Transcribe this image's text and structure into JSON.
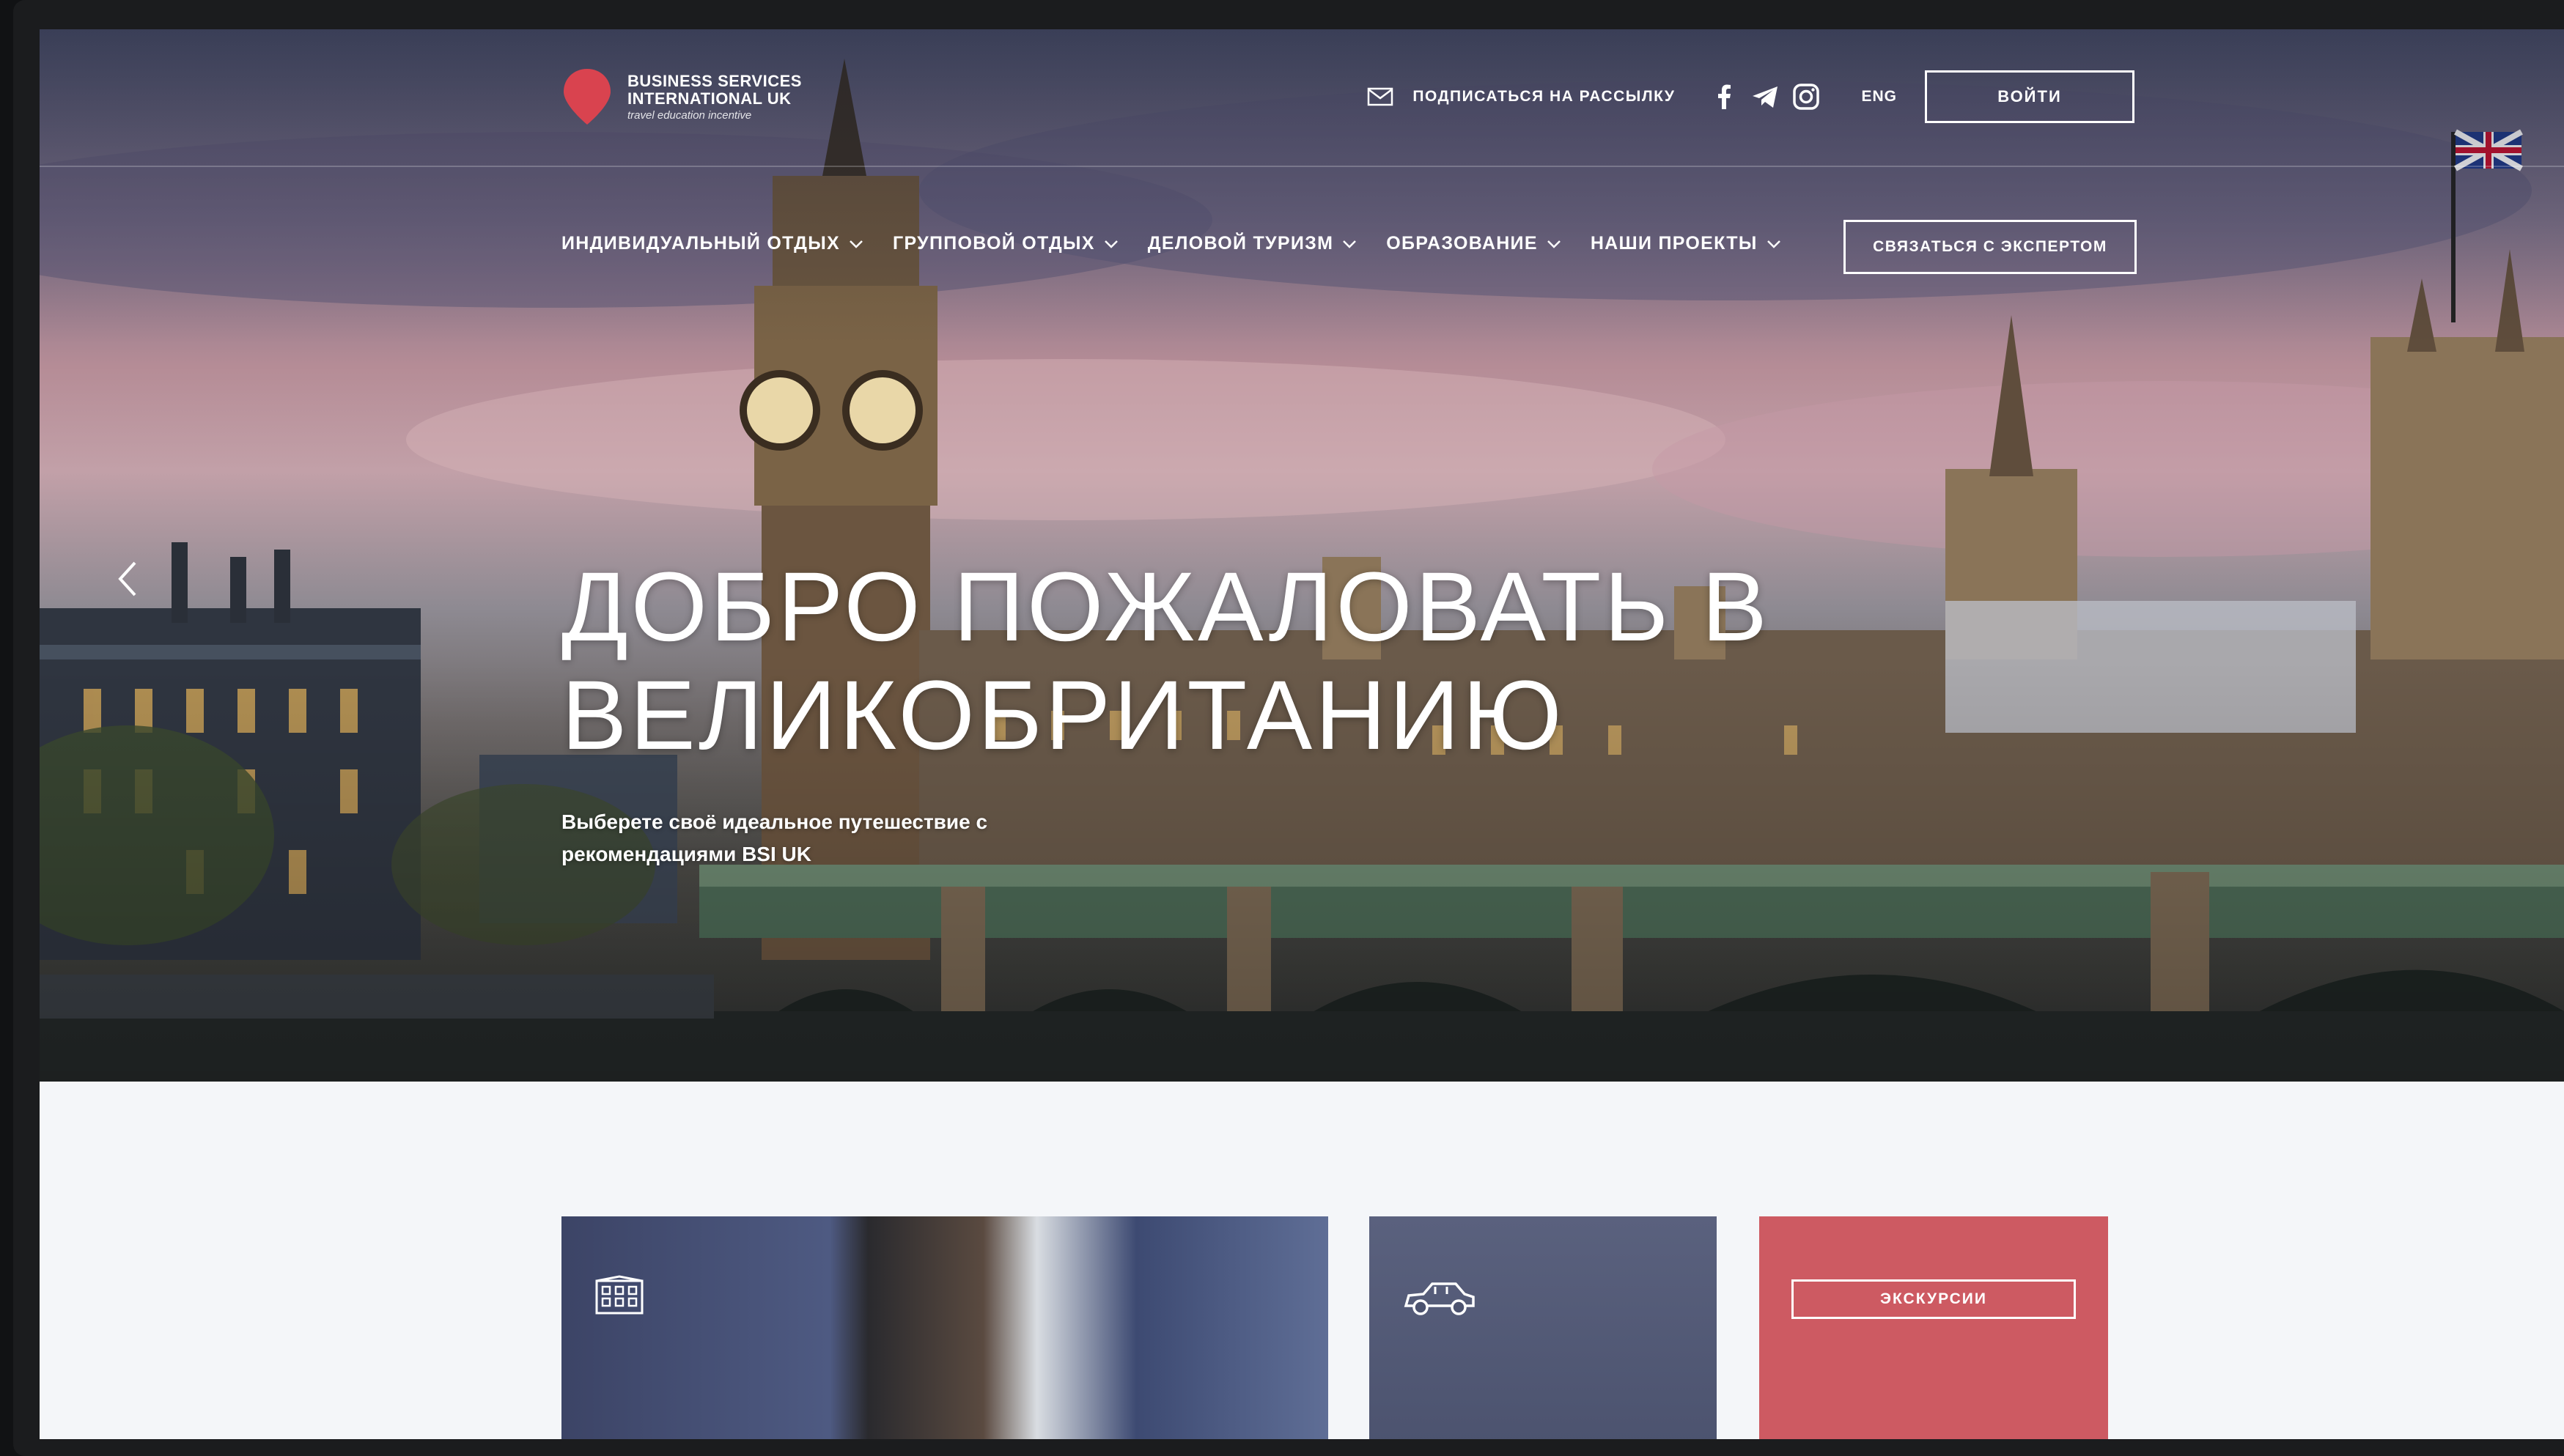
{
  "logo": {
    "line1": "BUSINESS SERVICES",
    "line2": "INTERNATIONAL UK",
    "tagline": "travel education incentive"
  },
  "topbar": {
    "subscribe_label": "ПОДПИСАТЬСЯ НА РАССЫЛКУ",
    "social_icons": [
      "facebook-icon",
      "telegram-icon",
      "instagram-icon"
    ],
    "lang_label": "ENG",
    "login_label": "ВОЙТИ"
  },
  "nav": {
    "items": [
      {
        "label": "ИНДИВИДУАЛЬНЫЙ ОТДЫХ"
      },
      {
        "label": "ГРУППОВОЙ ОТДЫХ"
      },
      {
        "label": "ДЕЛОВОЙ ТУРИЗМ"
      },
      {
        "label": "ОБРАЗОВАНИЕ"
      },
      {
        "label": "НАШИ ПРОЕКТЫ"
      }
    ],
    "expert_label": "СВЯЗАТЬСЯ С ЭКСПЕРТОМ"
  },
  "hero": {
    "title": "ДОБРО ПОЖАЛОВАТЬ В ВЕЛИКОБРИТАНИЮ",
    "subtitle": "Выберете своё идеальное путешествие с рекомендациями BSI UK"
  },
  "cards": {
    "tours_label": "ЭКСКУРСИИ"
  },
  "colors": {
    "brand_red": "#cd5a62",
    "pin_red": "#d9434f",
    "page_bg": "#f4f6f9"
  }
}
